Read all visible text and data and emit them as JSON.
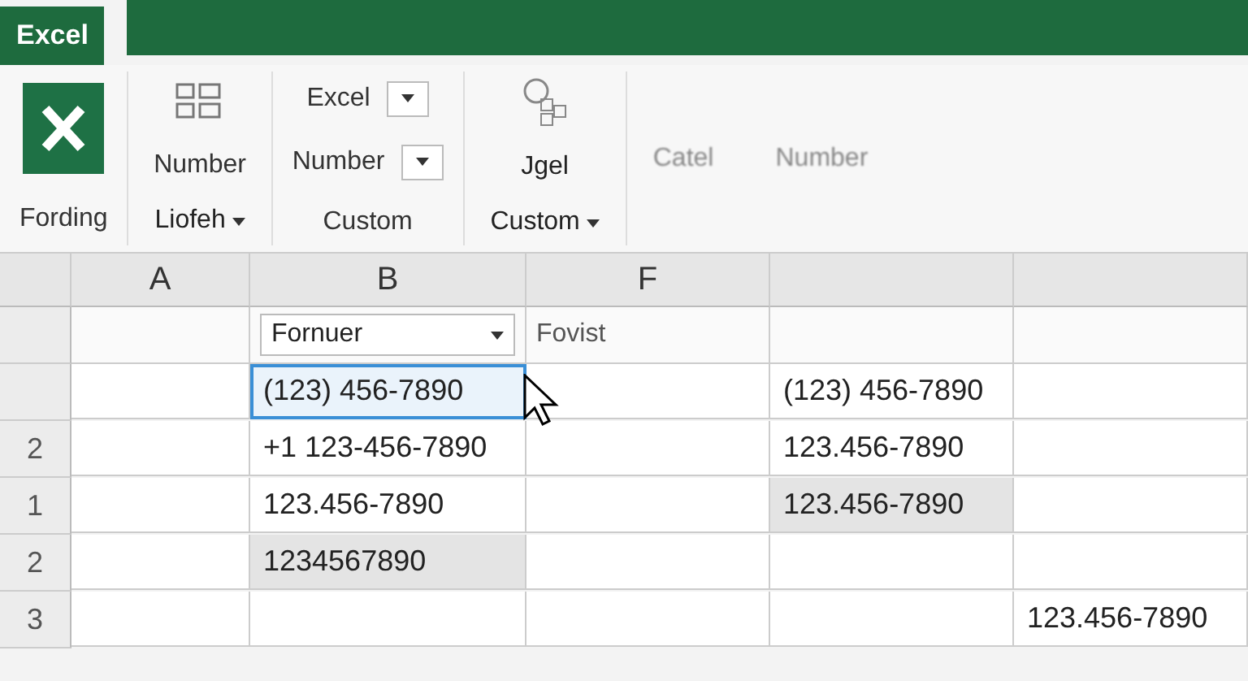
{
  "app_tab": "Excel",
  "ribbon": {
    "logo_label": "Fording",
    "number_button": "Number",
    "menu_button": "Liofeh",
    "format_labels": [
      "Excel",
      "Number",
      "Custom"
    ],
    "style_button": "Jgel",
    "custom_menu": "Custom",
    "cell_button": "Catel",
    "number_button_2": "Number"
  },
  "sheet": {
    "column_headers": [
      "A",
      "B",
      "F"
    ],
    "filters": [
      {
        "text": "Fornuer",
        "dropdown": true
      },
      {
        "text": "Fovist",
        "dropdown": false
      }
    ],
    "rows": [
      {
        "row_number": null,
        "cells": [
          null,
          {
            "text": "(123) 456-7890",
            "selected": true,
            "highlighted": false
          },
          null,
          {
            "text": "(123) 456-7890",
            "selected": false,
            "highlighted": false
          },
          null
        ]
      },
      {
        "row_number": "2",
        "cells": [
          null,
          {
            "text": "+1 123-456-7890",
            "selected": false,
            "highlighted": false
          },
          null,
          {
            "text": "123.456-7890",
            "selected": false,
            "highlighted": false
          },
          null
        ]
      },
      {
        "row_number": "1",
        "cells": [
          null,
          {
            "text": "123.456-7890",
            "selected": false,
            "highlighted": false
          },
          null,
          {
            "text": "123.456-7890",
            "selected": false,
            "highlighted": true
          },
          null
        ]
      },
      {
        "row_number": "2",
        "cells": [
          null,
          {
            "text": "1234567890",
            "selected": false,
            "highlighted": true
          },
          null,
          null,
          null
        ]
      },
      {
        "row_number": "3",
        "cells": [
          null,
          null,
          null,
          null,
          {
            "text": "123.456-7890",
            "selected": false,
            "highlighted": false
          }
        ]
      }
    ]
  }
}
